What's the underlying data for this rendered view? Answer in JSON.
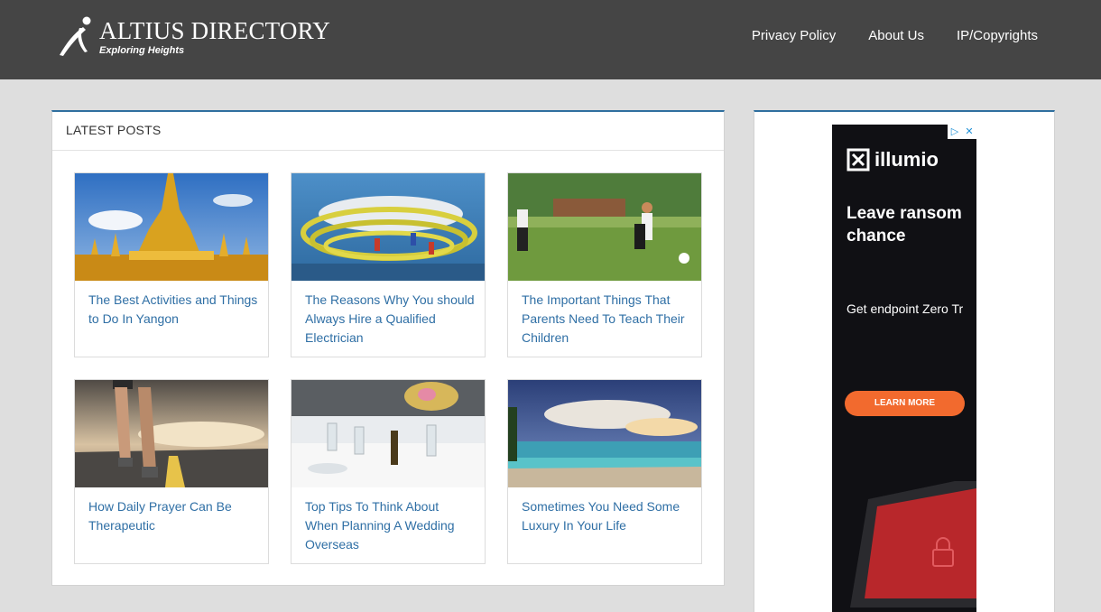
{
  "header": {
    "logo_title": "ALTIUS DIRECTORY",
    "logo_tagline": "Exploring Heights",
    "nav": [
      {
        "label": "Privacy Policy"
      },
      {
        "label": "About Us"
      },
      {
        "label": "IP/Copyrights"
      }
    ]
  },
  "latest": {
    "heading": "LATEST POSTS",
    "posts": [
      {
        "title": "The Best Activities and Things to Do In Yangon",
        "image": "golden-pagoda-image"
      },
      {
        "title": "The Reasons Why You should Always Hire a Qualified Electrician",
        "image": "cable-figurines-image"
      },
      {
        "title": "The Important Things That Parents Need To Teach Their Children",
        "image": "kids-soccer-image"
      },
      {
        "title": "How Daily Prayer Can Be Therapeutic",
        "image": "runner-road-image"
      },
      {
        "title": "Top Tips To Think About When Planning A Wedding Overseas",
        "image": "wedding-table-image"
      },
      {
        "title": "Sometimes You Need Some Luxury In Your Life",
        "image": "beach-sky-image"
      }
    ]
  },
  "ad": {
    "brand": "illumio",
    "headline_line1": "Leave ransom",
    "headline_line2": "chance",
    "subline": "Get endpoint Zero Tr",
    "cta": "LEARN MORE",
    "colors": {
      "background": "#101014",
      "cta": "#f26a2e"
    }
  },
  "colors": {
    "header": "#454545",
    "accent": "#2f6f9f",
    "link": "#2f6fa5",
    "page": "#dedede"
  }
}
